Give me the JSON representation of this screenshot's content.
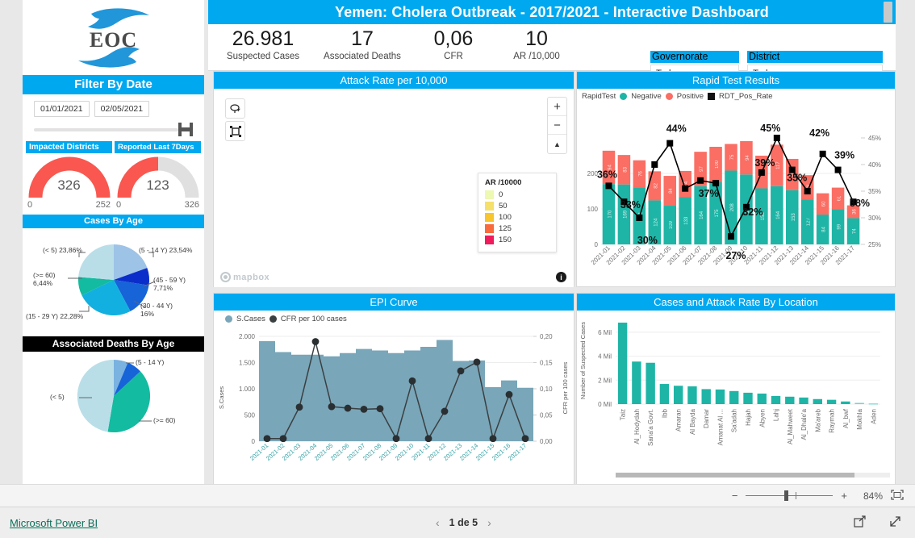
{
  "header": {
    "title": "Yemen: Cholera Outbreak - 2017/2021 - Interactive Dashboard"
  },
  "kpis": [
    {
      "value": "26.981",
      "label": "Suspected Cases"
    },
    {
      "value": "17",
      "label": "Associated Deaths"
    },
    {
      "value": "0,06",
      "label": "CFR"
    },
    {
      "value": "10",
      "label": "AR /10,000"
    }
  ],
  "slicers": [
    {
      "label": "Governorate",
      "value": "Todos"
    },
    {
      "label": "District",
      "value": "Todos"
    }
  ],
  "sidebar": {
    "logo_text": "EOC",
    "filter_title": "Filter By Date",
    "date_from": "01/01/2021",
    "date_to": "02/05/2021",
    "gauges": [
      {
        "title": "Impacted Districts",
        "value": "326",
        "min": "0",
        "max": "252",
        "pct": 100
      },
      {
        "title": "Reported Last 7Days",
        "value": "123",
        "min": "0",
        "max": "326",
        "pct": 38
      }
    ],
    "cases_by_age_title": "Cases By Age",
    "deaths_by_age_title": "Associated Deaths By Age"
  },
  "panels": {
    "map_title": "Attack Rate per 10,000",
    "rapid_title": "Rapid Test Results",
    "epi_title": "EPI Curve",
    "loc_title": "Cases and Attack Rate By Location"
  },
  "map": {
    "legend_title": "AR /10000",
    "legend": [
      {
        "label": "0",
        "color": "#edf8b1"
      },
      {
        "label": "50",
        "color": "#f4e06a"
      },
      {
        "label": "100",
        "color": "#f7c52d"
      },
      {
        "label": "125",
        "color": "#f96b3d"
      },
      {
        "label": "150",
        "color": "#f01b5b"
      }
    ],
    "attribution": "mapbox",
    "zoom_in": "+",
    "zoom_out": "−"
  },
  "chart_data": [
    {
      "type": "bar",
      "id": "rapid-test-results",
      "title": "Rapid Test Results",
      "stacked": true,
      "grid": true,
      "legend_position": "top",
      "legend_prefix": "RapidTest",
      "categories": [
        "2021-01",
        "2021-02",
        "2021-03",
        "2021-04",
        "2021-05",
        "2021-06",
        "2021-07",
        "2021-08",
        "2021-09",
        "2021-10",
        "2021-11",
        "2021-12",
        "2021-13",
        "2021-14",
        "2021-15",
        "2021-16",
        "2021-17"
      ],
      "series": [
        {
          "name": "Negative",
          "color": "#1eb5a6",
          "values": [
            170,
            169,
            161,
            124,
            109,
            133,
            164,
            175,
            208,
            197,
            158,
            164,
            153,
            127,
            84,
            99,
            74
          ]
        },
        {
          "name": "Positive",
          "color": "#fa6e64",
          "values": [
            94,
            83,
            76,
            82,
            84,
            74,
            97,
            100,
            75,
            94,
            92,
            117,
            88,
            68,
            60,
            61,
            36
          ]
        }
      ],
      "line_series": {
        "name": "RDT_Pos_Rate",
        "color": "#000000",
        "values": [
          0.36,
          0.33,
          0.3,
          0.4,
          0.44,
          0.355,
          0.37,
          0.365,
          0.265,
          0.32,
          0.385,
          0.45,
          0.39,
          0.35,
          0.42,
          0.39,
          0.33
        ]
      },
      "point_labels": [
        "36%",
        "33%",
        "30%",
        "",
        "44%",
        "",
        "37%",
        "",
        "27%",
        "32%",
        "39%",
        "45%",
        "35%",
        "",
        "42%",
        "39%",
        "38%"
      ],
      "ylabel": "",
      "ylim": [
        0,
        300
      ],
      "yticks": [
        "0",
        "100",
        "200"
      ],
      "y2label": "",
      "y2ticks": [
        "25%",
        "30%",
        "35%",
        "40%",
        "45%"
      ]
    },
    {
      "type": "area",
      "id": "epi-curve",
      "title": "EPI Curve",
      "grid": true,
      "legend_position": "top",
      "categories": [
        "2021-01",
        "2021-02",
        "2021-03",
        "2021-04",
        "2021-05",
        "2021-06",
        "2021-07",
        "2021-08",
        "2021-09",
        "2021-10",
        "2021-11",
        "2021-12",
        "2021-13",
        "2021-14",
        "2021-15",
        "2021-16",
        "2021-17"
      ],
      "series": [
        {
          "name": "S.Cases",
          "color": "#79a6b8",
          "values": [
            1910,
            1700,
            1650,
            1650,
            1620,
            1680,
            1760,
            1730,
            1680,
            1730,
            1800,
            1930,
            1530,
            1540,
            1030,
            1160,
            1020
          ]
        }
      ],
      "line_series": {
        "name": "CFR per 100 cases",
        "color": "#3a3f42",
        "values": [
          0.005,
          0.005,
          0.065,
          0.19,
          0.066,
          0.063,
          0.061,
          0.062,
          0.005,
          0.115,
          0.005,
          0.057,
          0.134,
          0.151,
          0.005,
          0.089,
          0.005
        ]
      },
      "ylabel": "S.Cases",
      "ylim": [
        0,
        2000
      ],
      "yticks": [
        "0",
        "500",
        "1.000",
        "1.500",
        "2.000"
      ],
      "y2label": "CFR per 100 cases",
      "y2ticks": [
        "0,00",
        "0,05",
        "0,10",
        "0,15",
        "0,20"
      ]
    },
    {
      "type": "bar",
      "id": "cases-by-location",
      "title": "Cases and Attack Rate By Location",
      "grid": true,
      "color": "#1eb5a6",
      "categories": [
        "Taiz",
        "Al_Hodydah",
        "Sana'a Govt.",
        "Ibb",
        "Amaran",
        "Al Bayda",
        "Damar",
        "Amanat Al ...",
        "Sa'adah",
        "Hajah",
        "Abyen",
        "Lahj",
        "Al_Mahweet",
        "Al_Dhale'a",
        "Ma'areb",
        "Raymah",
        "Al_bwf",
        "Mokhla",
        "Aden"
      ],
      "values": [
        6.8,
        3.55,
        3.45,
        1.68,
        1.53,
        1.48,
        1.25,
        1.22,
        1.09,
        0.95,
        0.88,
        0.68,
        0.62,
        0.55,
        0.42,
        0.36,
        0.22,
        0.1,
        0.05
      ],
      "ylabel": "Number of Suspected Cases",
      "ylim": [
        0,
        7
      ],
      "yticks": [
        "0 Mil",
        "2 Mil",
        "4 Mil",
        "6 Mil"
      ]
    },
    {
      "type": "pie",
      "id": "cases-by-age",
      "title": "Cases By Age",
      "labels": [
        "(5 - 14 Y) 23,54%",
        "(45 - 59 Y) 7,71%",
        "(30 - 44 Y) 16%",
        "(15 - 29 Y) 22,28%",
        "(>= 60) 6,44%",
        "(< 5) 23,86%"
      ],
      "values": [
        23.54,
        7.71,
        16,
        22.28,
        6.44,
        23.86
      ],
      "colors": [
        "#9dc3e6",
        "#0b2ecb",
        "#1763d8",
        "#12b0e0",
        "#13bba0",
        "#b9dee8"
      ]
    },
    {
      "type": "pie",
      "id": "deaths-by-age",
      "title": "Associated Deaths By Age",
      "labels": [
        "(5 - 14 Y)",
        "(>= 60)",
        "(< 5)"
      ],
      "values": [
        7,
        5,
        41,
        47
      ],
      "slice_labels": [
        "(5 - 14 Y)",
        "",
        "(>= 60)",
        "(< 5)"
      ],
      "colors": [
        "#7ab2e0",
        "#1763d8",
        "#13bba0",
        "#b9dee8"
      ]
    }
  ],
  "zoombar": {
    "minus": "−",
    "plus": "+",
    "percent": "84%",
    "fit_icon": "fit-to-page-icon"
  },
  "statusbar": {
    "brand": "Microsoft Power BI",
    "prev": "‹",
    "page": "1 de 5",
    "next": "›",
    "share_icon": "share-icon",
    "fullscreen_icon": "fullscreen-icon"
  }
}
